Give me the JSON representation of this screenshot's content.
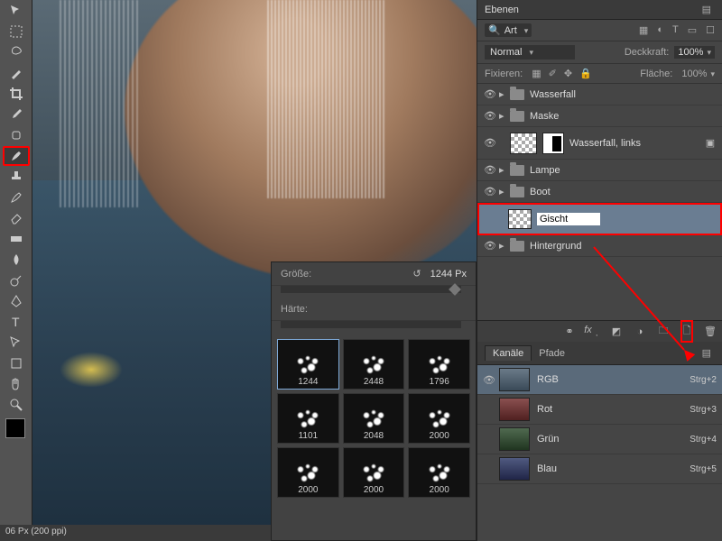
{
  "tools": [
    {
      "name": "move-tool"
    },
    {
      "name": "marquee-tool"
    },
    {
      "name": "lasso-tool"
    },
    {
      "name": "wand-tool"
    },
    {
      "name": "crop-tool"
    },
    {
      "name": "eyedropper-tool"
    },
    {
      "name": "healing-tool"
    },
    {
      "name": "brush-tool",
      "active": true
    },
    {
      "name": "stamp-tool"
    },
    {
      "name": "history-brush-tool"
    },
    {
      "name": "eraser-tool"
    },
    {
      "name": "gradient-tool"
    },
    {
      "name": "blur-tool"
    },
    {
      "name": "dodge-tool"
    },
    {
      "name": "pen-tool"
    },
    {
      "name": "type-tool"
    },
    {
      "name": "path-tool"
    },
    {
      "name": "shape-tool"
    },
    {
      "name": "hand-tool"
    },
    {
      "name": "zoom-tool"
    }
  ],
  "brush_panel": {
    "size_label": "Größe:",
    "size_value": "1244 Px",
    "hardness_label": "Härte:",
    "brushes": [
      {
        "size": "1244",
        "sel": true
      },
      {
        "size": "2448"
      },
      {
        "size": "1796"
      },
      {
        "size": "1101"
      },
      {
        "size": "2048"
      },
      {
        "size": "2000"
      },
      {
        "size": "2000"
      },
      {
        "size": "2000"
      },
      {
        "size": "2000"
      }
    ]
  },
  "layers_panel": {
    "title": "Ebenen",
    "filter_kind": "Art",
    "blend_mode": "Normal",
    "opacity_label": "Deckkraft:",
    "opacity_value": "100%",
    "lock_label": "Fixieren:",
    "fill_label": "Fläche:",
    "fill_value": "100%",
    "layers": [
      {
        "type": "group",
        "name": "Wasserfall"
      },
      {
        "type": "group",
        "name": "Maske"
      },
      {
        "type": "masked",
        "name": "Wasserfall, links"
      },
      {
        "type": "group",
        "name": "Lampe"
      },
      {
        "type": "group",
        "name": "Boot"
      },
      {
        "type": "editing",
        "name": "Gischt",
        "selected": true
      },
      {
        "type": "group",
        "name": "Hintergrund"
      }
    ]
  },
  "channels_panel": {
    "tabs": [
      "Kanäle",
      "Pfade"
    ],
    "channels": [
      {
        "name": "RGB",
        "thumb": "rgb",
        "shortcut": "Strg+2"
      },
      {
        "name": "Rot",
        "thumb": "r",
        "shortcut": "Strg+3"
      },
      {
        "name": "Grün",
        "thumb": "g",
        "shortcut": "Strg+4"
      },
      {
        "name": "Blau",
        "thumb": "b",
        "shortcut": "Strg+5"
      }
    ]
  },
  "statusbar": {
    "text": "06 Px (200 ppi)"
  }
}
